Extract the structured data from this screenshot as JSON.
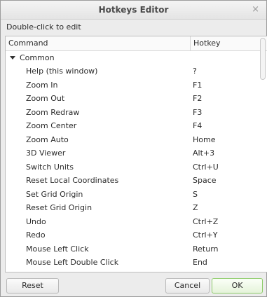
{
  "window": {
    "title": "Hotkeys Editor",
    "close_glyph": "×"
  },
  "subtitle": "Double-click to edit",
  "table": {
    "columns": [
      "Command",
      "Hotkey"
    ],
    "group": "Common",
    "rows": [
      [
        "Help (this window)",
        "?"
      ],
      [
        "Zoom In",
        "F1"
      ],
      [
        "Zoom Out",
        "F2"
      ],
      [
        "Zoom Redraw",
        "F3"
      ],
      [
        "Zoom Center",
        "F4"
      ],
      [
        "Zoom Auto",
        "Home"
      ],
      [
        "3D Viewer",
        "Alt+3"
      ],
      [
        "Switch Units",
        "Ctrl+U"
      ],
      [
        "Reset Local Coordinates",
        "Space"
      ],
      [
        "Set Grid Origin",
        "S"
      ],
      [
        "Reset Grid Origin",
        "Z"
      ],
      [
        "Undo",
        "Ctrl+Z"
      ],
      [
        "Redo",
        "Ctrl+Y"
      ],
      [
        "Mouse Left Click",
        "Return"
      ],
      [
        "Mouse Left Double Click",
        "End"
      ]
    ]
  },
  "buttons": {
    "reset": "Reset",
    "cancel": "Cancel",
    "ok": "OK"
  }
}
